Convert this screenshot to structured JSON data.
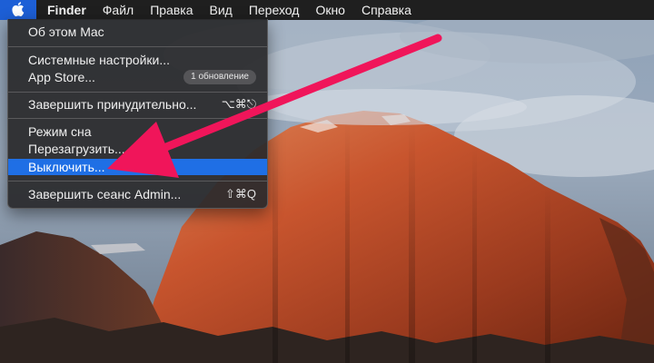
{
  "menubar": {
    "apple_icon": "apple-logo-icon",
    "app_name": "Finder",
    "items": [
      "Файл",
      "Правка",
      "Вид",
      "Переход",
      "Окно",
      "Справка"
    ]
  },
  "apple_menu": {
    "about": "Об этом Mac",
    "system_prefs": "Системные настройки...",
    "app_store": "App Store...",
    "app_store_badge": "1 обновление",
    "force_quit": "Завершить принудительно...",
    "force_quit_shortcut": "⌥⌘⎋",
    "sleep": "Режим сна",
    "restart": "Перезагрузить...",
    "shutdown": "Выключить...",
    "logout": "Завершить сеанс Admin...",
    "logout_shortcut": "⇧⌘Q"
  },
  "colors": {
    "highlight": "#1f6fe5",
    "arrow": "#f0155a",
    "menubar": "#1f1f1f"
  }
}
